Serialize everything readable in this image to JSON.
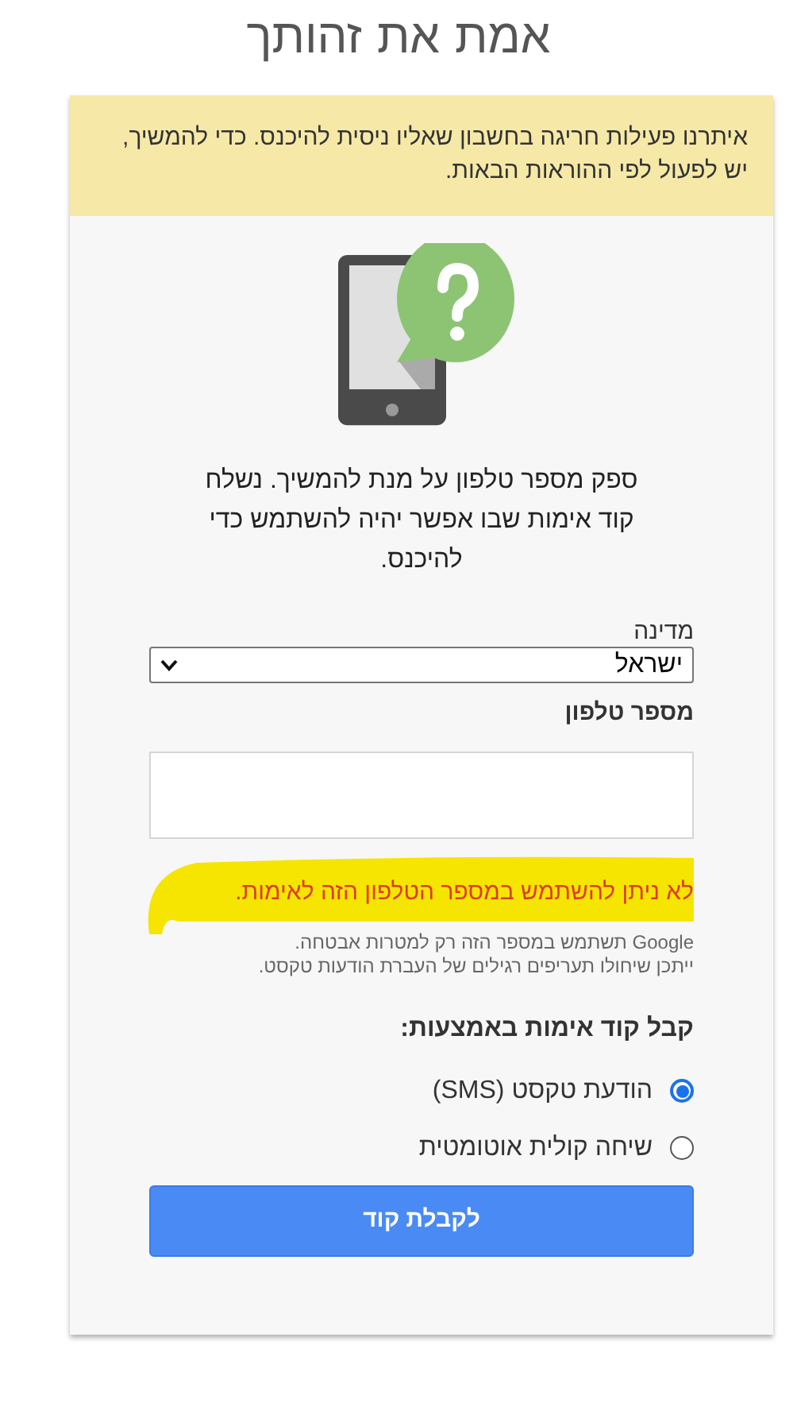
{
  "title": "אמת את זהותך",
  "alert": {
    "text": "איתרנו פעילות חריגה בחשבון שאליו ניסית להיכנס. כדי להמשיך, יש לפעול לפי ההוראות הבאות."
  },
  "intro": "ספק מספר טלפון על מנת להמשיך. נשלח קוד אימות שבו אפשר יהיה להשתמש כדי להיכנס.",
  "country": {
    "label": "מדינה",
    "value": "ישראל"
  },
  "phone": {
    "label": "מספר טלפון"
  },
  "error": {
    "text": "לא ניתן להשתמש במספר הטלפון הזה לאימות.",
    "highlighted": true
  },
  "notes": [
    "Google תשתמש במספר הזה רק למטרות אבטחה.",
    "ייתכן שיחולו תעריפים רגילים של העברת הודעות טקסט."
  ],
  "method": {
    "heading": "קבל קוד אימות באמצעות:",
    "options": [
      {
        "label": "הודעת טקסט (SMS)",
        "selected": true
      },
      {
        "label": "שיחה קולית אוטומטית",
        "selected": false
      }
    ]
  },
  "submit": "לקבלת קוד"
}
